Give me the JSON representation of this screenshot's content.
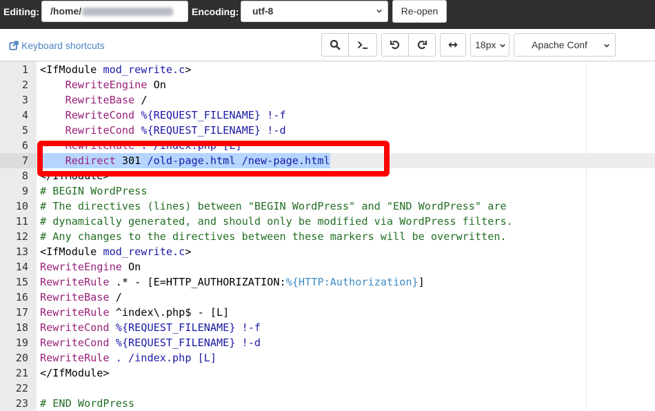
{
  "topbar": {
    "editing_label": "Editing:",
    "path_visible": "/home/",
    "path_redacted": true,
    "encoding_label": "Encoding:",
    "encoding_value": "utf-8",
    "reopen_label": "Re-open"
  },
  "toolbar": {
    "keyboard_shortcuts_label": "Keyboard shortcuts",
    "buttons": [
      {
        "name": "search",
        "icon": "search-icon"
      },
      {
        "name": "goto-line",
        "icon": "terminal-icon"
      },
      {
        "name": "undo",
        "icon": "undo-icon"
      },
      {
        "name": "redo",
        "icon": "redo-icon"
      },
      {
        "name": "toggle-wrap",
        "icon": "arrows-horizontal-icon"
      }
    ],
    "font_size_value": "18px",
    "mode_value": "Apache Conf"
  },
  "editor": {
    "active_line": 7,
    "lines": [
      {
        "n": "1",
        "tokens": [
          {
            "t": "<IfModule ",
            "c": "plain"
          },
          {
            "t": "mod_rewrite.c",
            "c": "kw"
          },
          {
            "t": ">",
            "c": "plain"
          }
        ]
      },
      {
        "n": "2",
        "tokens": [
          {
            "t": "    ",
            "c": "plain"
          },
          {
            "t": "RewriteEngine",
            "c": "dir"
          },
          {
            "t": " On",
            "c": "plain"
          }
        ]
      },
      {
        "n": "3",
        "tokens": [
          {
            "t": "    ",
            "c": "plain"
          },
          {
            "t": "RewriteBase",
            "c": "dir"
          },
          {
            "t": " /",
            "c": "plain"
          }
        ]
      },
      {
        "n": "4",
        "tokens": [
          {
            "t": "    ",
            "c": "plain"
          },
          {
            "t": "RewriteCond",
            "c": "dir"
          },
          {
            "t": " %{REQUEST_FILENAME} !-f",
            "c": "var"
          }
        ]
      },
      {
        "n": "5",
        "tokens": [
          {
            "t": "    ",
            "c": "plain"
          },
          {
            "t": "RewriteCond",
            "c": "dir"
          },
          {
            "t": " %{REQUEST_FILENAME} !-d",
            "c": "var"
          }
        ]
      },
      {
        "n": "6",
        "tokens": [
          {
            "t": "    ",
            "c": "plain"
          },
          {
            "t": "RewriteRule",
            "c": "dir"
          },
          {
            "t": " . /index.php [L]",
            "c": "var"
          }
        ]
      },
      {
        "n": "7",
        "selected": true,
        "tokens": [
          {
            "t": "    ",
            "c": "plain"
          },
          {
            "t": "Redirect",
            "c": "dir"
          },
          {
            "t": " 301 ",
            "c": "plain"
          },
          {
            "t": "/old-page.html /new-page.html",
            "c": "kw"
          }
        ]
      },
      {
        "n": "8",
        "tokens": [
          {
            "t": "</IfModule>",
            "c": "plain"
          }
        ]
      },
      {
        "n": "9",
        "tokens": [
          {
            "t": "# BEGIN WordPress",
            "c": "com"
          }
        ]
      },
      {
        "n": "10",
        "tokens": [
          {
            "t": "# The directives (lines) between \"BEGIN WordPress\" and \"END WordPress\" are",
            "c": "com"
          }
        ]
      },
      {
        "n": "11",
        "tokens": [
          {
            "t": "# dynamically generated, and should only be modified via WordPress filters.",
            "c": "com"
          }
        ]
      },
      {
        "n": "12",
        "tokens": [
          {
            "t": "# Any changes to the directives between these markers will be overwritten.",
            "c": "com"
          }
        ]
      },
      {
        "n": "13",
        "tokens": [
          {
            "t": "<IfModule ",
            "c": "plain"
          },
          {
            "t": "mod_rewrite.c",
            "c": "kw"
          },
          {
            "t": ">",
            "c": "plain"
          }
        ]
      },
      {
        "n": "14",
        "tokens": [
          {
            "t": "RewriteEngine",
            "c": "dir"
          },
          {
            "t": " On",
            "c": "plain"
          }
        ]
      },
      {
        "n": "15",
        "tokens": [
          {
            "t": "RewriteRule",
            "c": "dir"
          },
          {
            "t": " .* - [E=HTTP_AUTHORIZATION:",
            "c": "plain"
          },
          {
            "t": "%{HTTP:Authorization}",
            "c": "env"
          },
          {
            "t": "]",
            "c": "plain"
          }
        ]
      },
      {
        "n": "16",
        "tokens": [
          {
            "t": "RewriteBase",
            "c": "dir"
          },
          {
            "t": " /",
            "c": "plain"
          }
        ]
      },
      {
        "n": "17",
        "tokens": [
          {
            "t": "RewriteRule",
            "c": "dir"
          },
          {
            "t": " ^index\\.php$ - [L]",
            "c": "plain"
          }
        ]
      },
      {
        "n": "18",
        "tokens": [
          {
            "t": "RewriteCond",
            "c": "dir"
          },
          {
            "t": " %{REQUEST_FILENAME} !-f",
            "c": "var"
          }
        ]
      },
      {
        "n": "19",
        "tokens": [
          {
            "t": "RewriteCond",
            "c": "dir"
          },
          {
            "t": " %{REQUEST_FILENAME} !-d",
            "c": "var"
          }
        ]
      },
      {
        "n": "20",
        "tokens": [
          {
            "t": "RewriteRule",
            "c": "dir"
          },
          {
            "t": " . /index.php [L]",
            "c": "var"
          }
        ]
      },
      {
        "n": "21",
        "tokens": [
          {
            "t": "</IfModule>",
            "c": "plain"
          }
        ]
      },
      {
        "n": "22",
        "tokens": []
      },
      {
        "n": "23",
        "tokens": [
          {
            "t": "# END WordPress",
            "c": "com"
          }
        ]
      }
    ]
  },
  "annotation": {
    "color": "#ff0000",
    "target_line": 7
  }
}
